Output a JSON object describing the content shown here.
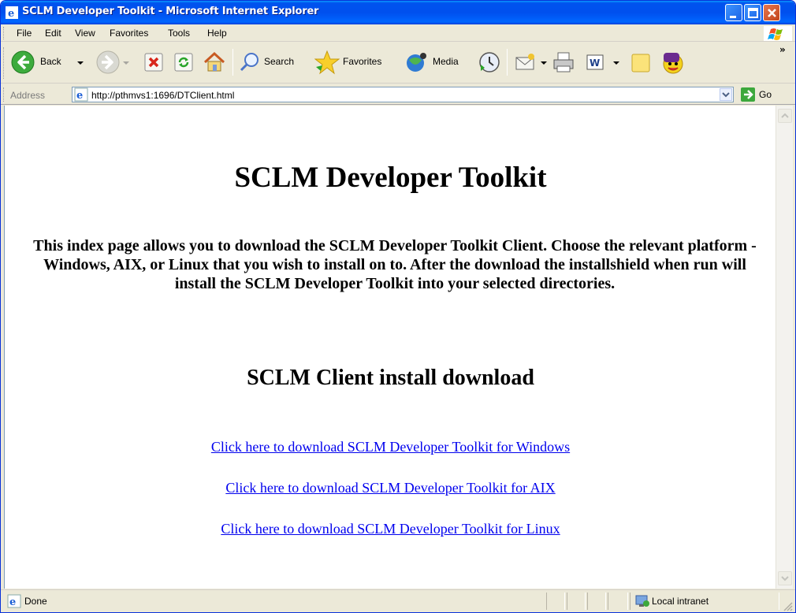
{
  "window": {
    "title": "SCLM Developer Toolkit - Microsoft Internet Explorer"
  },
  "menu": [
    "File",
    "Edit",
    "View",
    "Favorites",
    "Tools",
    "Help"
  ],
  "toolbar": {
    "back_label": "Back",
    "search_label": "Search",
    "favorites_label": "Favorites",
    "media_label": "Media"
  },
  "address": {
    "label": "Address",
    "url": "http://pthmvs1:1696/DTClient.html",
    "go_label": "Go"
  },
  "page": {
    "heading": "SCLM Developer Toolkit",
    "intro": "This index page allows you to download the SCLM Developer Toolkit Client. Choose the relevant platform - Windows, AIX, or Linux that you wish to install on to. After the download the installshield when run will install the SCLM Developer Toolkit into your selected directories.",
    "subheading": "SCLM Client install download",
    "links": [
      "Click here to download SCLM Developer Toolkit for Windows",
      "Click here to download SCLM Developer Toolkit for AIX",
      "Click here to download SCLM Developer Toolkit for Linux"
    ]
  },
  "status": {
    "text": "Done",
    "zone": "Local intranet"
  },
  "colors": {
    "titlebar": "#0053ee",
    "link": "#0000ee",
    "chrome": "#ece9d8"
  }
}
